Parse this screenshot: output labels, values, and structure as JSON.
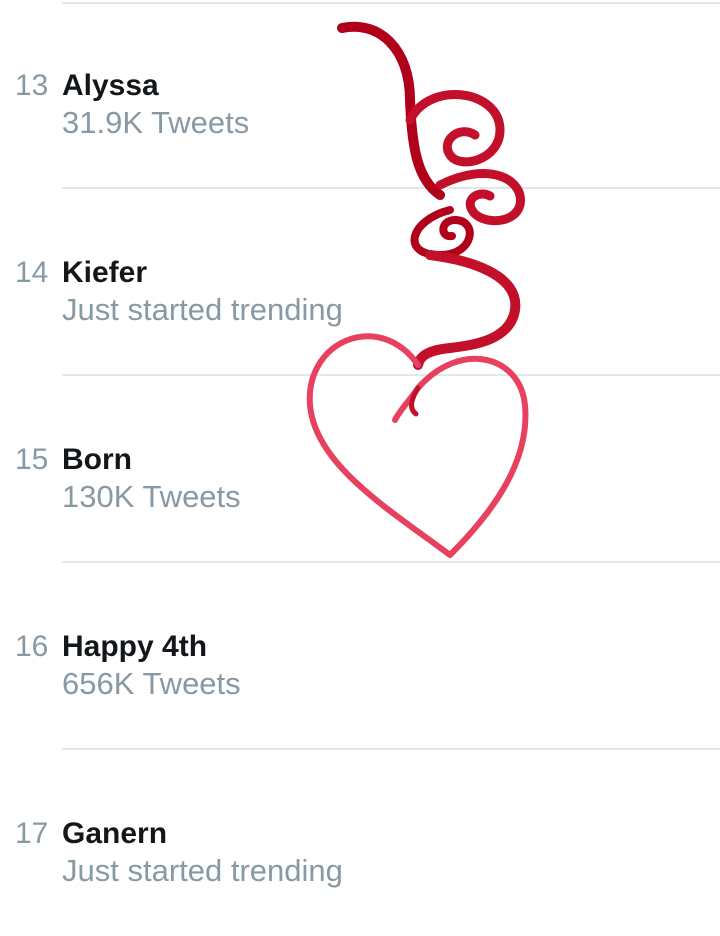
{
  "trends": [
    {
      "rank": "13",
      "name": "Alyssa",
      "meta": "31.9K Tweets"
    },
    {
      "rank": "14",
      "name": "Kiefer",
      "meta": "Just started trending"
    },
    {
      "rank": "15",
      "name": "Born",
      "meta": "130K Tweets"
    },
    {
      "rank": "16",
      "name": "Happy 4th",
      "meta": "656K Tweets"
    },
    {
      "rank": "17",
      "name": "Ganern",
      "meta": "Just started trending"
    }
  ],
  "colors": {
    "divider": "#e1e8ed",
    "muted_text": "#8899a6",
    "primary_text": "#14171a",
    "ribbon_dark": "#b0001a",
    "ribbon_light": "#e8405f"
  },
  "decoration": {
    "icon": "ribbon-heart-icon"
  }
}
